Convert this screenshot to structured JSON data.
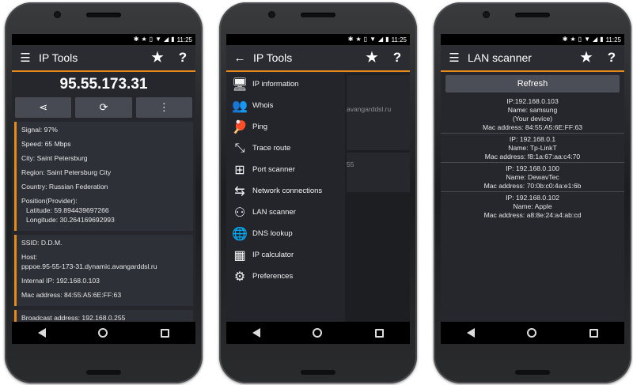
{
  "status": {
    "time": "11:25"
  },
  "screen1": {
    "title": "IP Tools",
    "ip": "95.55.173.31",
    "card1": {
      "signal": "Signal: 97%",
      "speed": "Speed: 65 Mbps",
      "city": "City: Saint Petersburg",
      "region": "Region: Saint Petersburg City",
      "country": "Country: Russian Federation",
      "position": "Position(Provider):",
      "latitude": "Latitude: 59.894439697266",
      "longitude": "Longitude: 30.264169692993"
    },
    "card2": {
      "ssid": "SSID: D.D.M.",
      "host_label": "Host:",
      "host_value": "pppoe.95-55-173-31.dynamic.avangarddsl.ru",
      "internal_ip": "Internal IP: 192.168.0.103",
      "mac": "Mac address: 84:55:A5:6E:FF:63"
    },
    "card3": {
      "broadcast": "Broadcast address: 192.168.0.255"
    }
  },
  "screen2": {
    "title": "IP Tools",
    "menu": [
      {
        "label": "IP information",
        "icon": "monitor-icon"
      },
      {
        "label": "Whois",
        "icon": "people-icon"
      },
      {
        "label": "Ping",
        "icon": "ping-pong-icon"
      },
      {
        "label": "Trace route",
        "icon": "route-icon"
      },
      {
        "label": "Port scanner",
        "icon": "network-tree-icon"
      },
      {
        "label": "Network connections",
        "icon": "connections-icon"
      },
      {
        "label": "LAN scanner",
        "icon": "lan-icon"
      },
      {
        "label": "DNS lookup",
        "icon": "globe-icon"
      },
      {
        "label": "IP calculator",
        "icon": "calculator-icon"
      },
      {
        "label": "Preferences",
        "icon": "gear-icon"
      }
    ],
    "background_fragment_1": "avangarddsl.ru",
    "background_fragment_2": "55"
  },
  "screen3": {
    "title": "LAN scanner",
    "refresh_label": "Refresh",
    "hosts": [
      {
        "ip": "IP:192.168.0.103",
        "name": "Name: samsung",
        "note": "(Your device)",
        "mac": "Mac address: 84:55:A5:6E:FF:63"
      },
      {
        "ip": "IP: 192.168.0.1",
        "name": "Name: Tp-LinkT",
        "mac": "Mac address: f8:1a:67:aa:c4:70"
      },
      {
        "ip": "IP: 192.168.0.100",
        "name": "Name: DewavTec",
        "mac": "Mac address: 70:0b:c0:4a:e1:6b"
      },
      {
        "ip": "IP: 192.168.0.102",
        "name": "Name: Apple",
        "mac": "Mac address: a8:8e:24:a4:ab:cd"
      }
    ]
  }
}
